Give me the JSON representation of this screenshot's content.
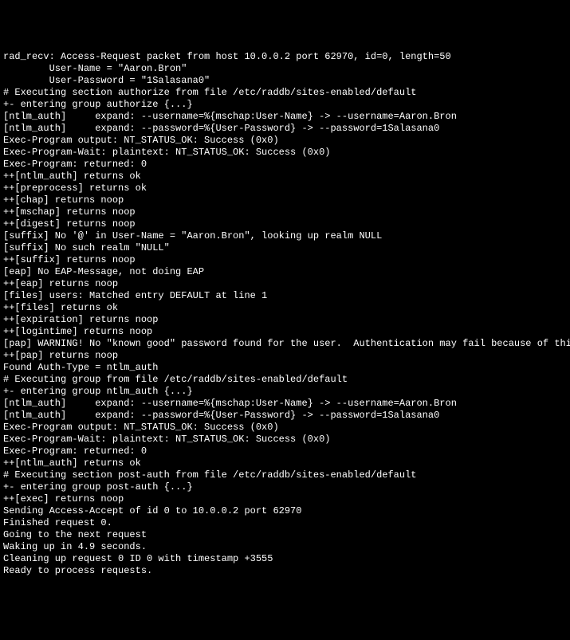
{
  "lines": [
    "rad_recv: Access-Request packet from host 10.0.0.2 port 62970, id=0, length=50",
    "        User-Name = \"Aaron.Bron\"",
    "        User-Password = \"1Salasana0\"",
    "# Executing section authorize from file /etc/raddb/sites-enabled/default",
    "+- entering group authorize {...}",
    "[ntlm_auth]     expand: --username=%{mschap:User-Name} -> --username=Aaron.Bron",
    "[ntlm_auth]     expand: --password=%{User-Password} -> --password=1Salasana0",
    "Exec-Program output: NT_STATUS_OK: Success (0x0)",
    "Exec-Program-Wait: plaintext: NT_STATUS_OK: Success (0x0)",
    "Exec-Program: returned: 0",
    "++[ntlm_auth] returns ok",
    "++[preprocess] returns ok",
    "++[chap] returns noop",
    "++[mschap] returns noop",
    "++[digest] returns noop",
    "[suffix] No '@' in User-Name = \"Aaron.Bron\", looking up realm NULL",
    "[suffix] No such realm \"NULL\"",
    "++[suffix] returns noop",
    "[eap] No EAP-Message, not doing EAP",
    "++[eap] returns noop",
    "[files] users: Matched entry DEFAULT at line 1",
    "++[files] returns ok",
    "++[expiration] returns noop",
    "++[logintime] returns noop",
    "[pap] WARNING! No \"known good\" password found for the user.  Authentication may fail because of this.",
    "++[pap] returns noop",
    "Found Auth-Type = ntlm_auth",
    "# Executing group from file /etc/raddb/sites-enabled/default",
    "+- entering group ntlm_auth {...}",
    "[ntlm_auth]     expand: --username=%{mschap:User-Name} -> --username=Aaron.Bron",
    "[ntlm_auth]     expand: --password=%{User-Password} -> --password=1Salasana0",
    "Exec-Program output: NT_STATUS_OK: Success (0x0)",
    "Exec-Program-Wait: plaintext: NT_STATUS_OK: Success (0x0)",
    "Exec-Program: returned: 0",
    "++[ntlm_auth] returns ok",
    "# Executing section post-auth from file /etc/raddb/sites-enabled/default",
    "+- entering group post-auth {...}",
    "++[exec] returns noop",
    "Sending Access-Accept of id 0 to 10.0.0.2 port 62970",
    "Finished request 0.",
    "Going to the next request",
    "Waking up in 4.9 seconds.",
    "Cleaning up request 0 ID 0 with timestamp +3555",
    "Ready to process requests."
  ]
}
